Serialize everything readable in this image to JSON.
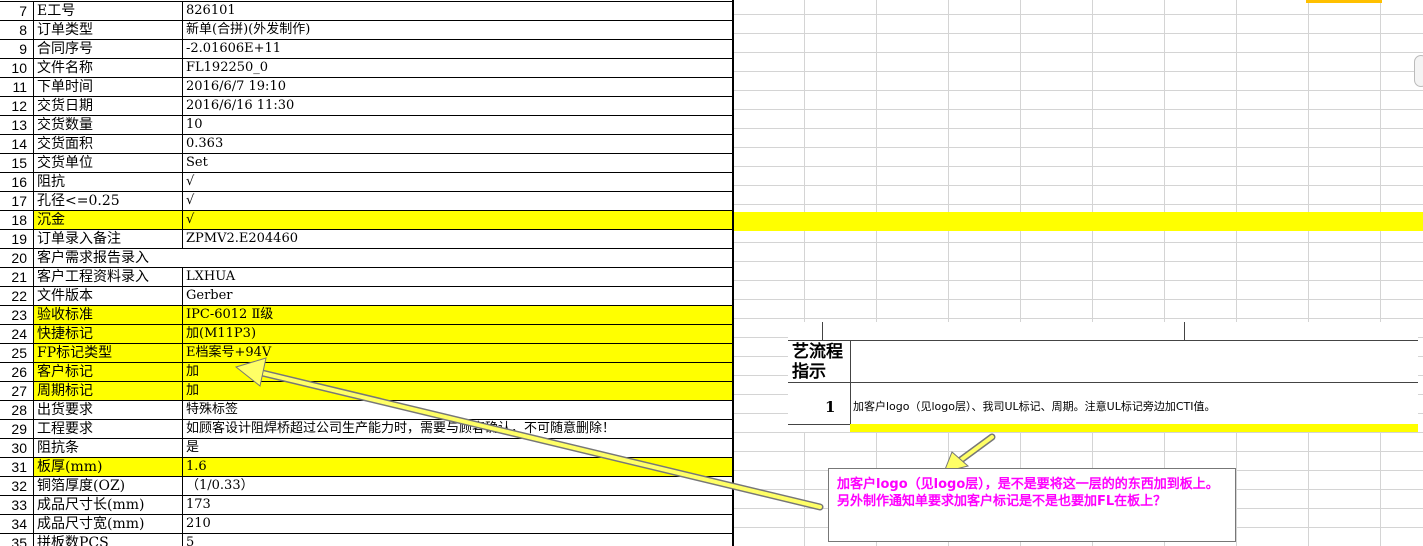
{
  "sheet": {
    "rows": [
      {
        "num": "7",
        "label": "E工号",
        "value": "826101",
        "hl": false
      },
      {
        "num": "8",
        "label": "订单类型",
        "value": "新单(合拼)(外发制作)",
        "hl": false
      },
      {
        "num": "9",
        "label": "合同序号",
        "value": "-2.01606E+11",
        "hl": false
      },
      {
        "num": "10",
        "label": "文件名称",
        "value": "FL192250_0",
        "hl": false
      },
      {
        "num": "11",
        "label": "下单时间",
        "value": "2016/6/7 19:10",
        "hl": false
      },
      {
        "num": "12",
        "label": "交货日期",
        "value": "2016/6/16 11:30",
        "hl": false
      },
      {
        "num": "13",
        "label": "交货数量",
        "value": "10",
        "hl": false
      },
      {
        "num": "14",
        "label": "交货面积",
        "value": "0.363",
        "hl": false
      },
      {
        "num": "15",
        "label": "交货单位",
        "value": "Set",
        "hl": false
      },
      {
        "num": "16",
        "label": "阻抗",
        "value": "√",
        "hl": false
      },
      {
        "num": "17",
        "label": "孔径<=0.25",
        "value": "√",
        "hl": false
      },
      {
        "num": "18",
        "label": "沉金",
        "value": "√",
        "hl": true
      },
      {
        "num": "19",
        "label": "订单录入备注",
        "value": "ZPMV2.E204460",
        "hl": false
      },
      {
        "num": "20",
        "label": "客户需求报告录入",
        "value": "",
        "hl": false,
        "nosplit": true
      },
      {
        "num": "21",
        "label": "客户工程资料录入",
        "value": "LXHUA",
        "hl": false
      },
      {
        "num": "22",
        "label": "文件版本",
        "value": "Gerber",
        "hl": false
      },
      {
        "num": "23",
        "label": "验收标准",
        "value": "IPC-6012 Ⅱ级",
        "hl": true
      },
      {
        "num": "24",
        "label": "快捷标记",
        "value": "加(M11P3)",
        "hl": true
      },
      {
        "num": "25",
        "label": "FP标记类型",
        "value": "E档案号+94V",
        "hl": true
      },
      {
        "num": "26",
        "label": "客户标记",
        "value": "加",
        "hl": true
      },
      {
        "num": "27",
        "label": "周期标记",
        "value": "加",
        "hl": true
      },
      {
        "num": "28",
        "label": "出货要求",
        "value": "特殊标签",
        "hl": false
      },
      {
        "num": "29",
        "label": "工程要求",
        "value": "如顾客设计阻焊桥超过公司生产能力时，需要与顾客确认，不可随意删除！",
        "hl": false
      },
      {
        "num": "30",
        "label": "阻抗条",
        "value": "是",
        "hl": false
      },
      {
        "num": "31",
        "label": "板厚(mm)",
        "value": "1.6",
        "hl": true
      },
      {
        "num": "32",
        "label": "铜箔厚度(OZ)",
        "value": "（1/0.33）",
        "hl": false
      },
      {
        "num": "33",
        "label": "成品尺寸长(mm)",
        "value": "173",
        "hl": false
      },
      {
        "num": "34",
        "label": "成品尺寸宽(mm)",
        "value": "210",
        "hl": false
      },
      {
        "num": "35",
        "label": "拼板数PCS",
        "value": "5",
        "hl": false
      }
    ]
  },
  "doc": {
    "header_text": "艺流程\n指示",
    "row_num": "1",
    "row_text": "加客户logo（见logo层）、我司UL标记、周期。注意UL标记旁边加CTI值。"
  },
  "callout": {
    "text": "加客户logo（见logo层），是不是要将这一层的的东西加到板上。另外制作通知单要求加客户标记是不是也要加FL在板上？"
  },
  "colors": {
    "highlight": "#ffff00",
    "callout_text": "#ff00ff",
    "arrow": "#ffff66"
  }
}
